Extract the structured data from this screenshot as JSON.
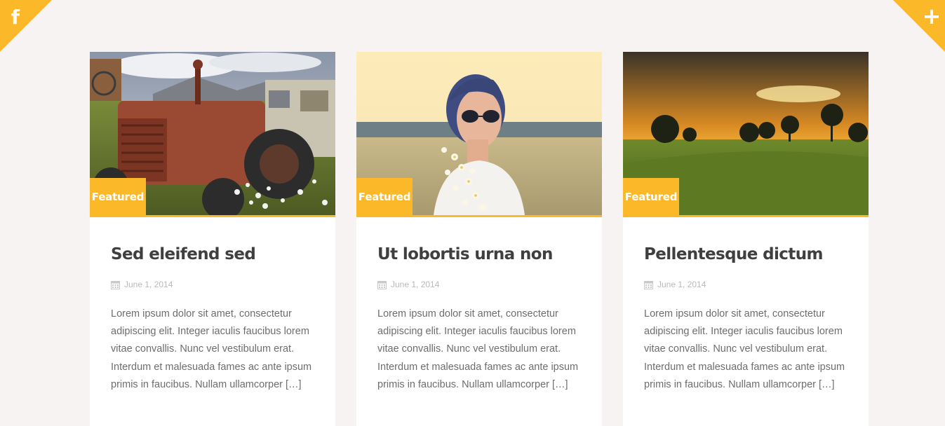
{
  "theme": {
    "accent": "#fbb829",
    "background": "#f8f3f3",
    "card_background": "#ffffff",
    "title_color": "#3f3f3f",
    "text_color": "#6d6d6d",
    "meta_color": "#b9b9b9"
  },
  "corners": {
    "left_icon": "facebook-icon",
    "left_glyph": "f",
    "right_icon": "plus-icon",
    "right_glyph": "+"
  },
  "posts": [
    {
      "image": "rusty-tractor-photo",
      "badge": "Featured",
      "title": "Sed eleifend sed",
      "date_icon": "calendar-icon",
      "date": "June 1, 2014",
      "excerpt": "Lorem ipsum dolor sit amet, consectetur adipiscing elit. Integer iaculis faucibus lorem vitae convallis. Nunc vel vestibulum erat. Interdum et malesuada fames ac ante ipsum primis in faucibus. Nullam ullamcorper […]"
    },
    {
      "image": "woman-with-flowers-photo",
      "badge": "Featured",
      "title": "Ut lobortis urna non",
      "date_icon": "calendar-icon",
      "date": "June 1, 2014",
      "excerpt": "Lorem ipsum dolor sit amet, consectetur adipiscing elit. Integer iaculis faucibus lorem vitae convallis. Nunc vel vestibulum erat. Interdum et malesuada fames ac ante ipsum primis in faucibus. Nullam ullamcorper […]"
    },
    {
      "image": "sunset-field-photo",
      "badge": "Featured",
      "title": "Pellentesque dictum",
      "date_icon": "calendar-icon",
      "date": "June 1, 2014",
      "excerpt": "Lorem ipsum dolor sit amet, consectetur adipiscing elit. Integer iaculis faucibus lorem vitae convallis. Nunc vel vestibulum erat. Interdum et malesuada fames ac ante ipsum primis in faucibus. Nullam ullamcorper […]"
    }
  ]
}
